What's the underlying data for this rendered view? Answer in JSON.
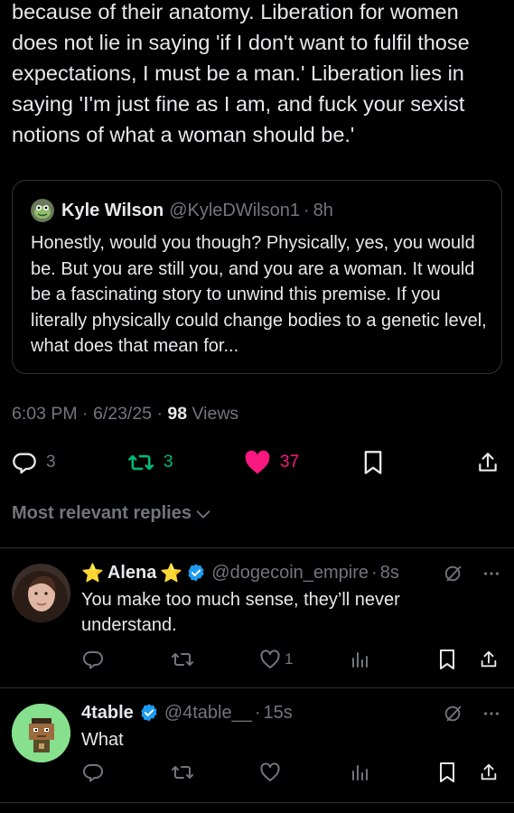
{
  "post": {
    "text": "because of their anatomy. Liberation for women\ndoes not lie in saying 'if I don't want to fulfil those\nexpectations, I must be a man.' Liberation lies in\nsaying 'I'm just fine as I am, and fuck your sexist\nnotions of what a woman should be.'"
  },
  "quote": {
    "name": "Kyle Wilson",
    "handle": "@KyleDWilson1",
    "separator": "·",
    "time": "8h",
    "text": "Honestly, would you though? Physically, yes, you would be. But you are still you, and you are a woman. It would be a fascinating story to unwind this premise. If you literally physically could change bodies to a genetic level, what does that mean for..."
  },
  "meta": {
    "time": "6:03 PM",
    "date": "6/23/25",
    "separator": "·",
    "views_count": "98",
    "views_label": "Views"
  },
  "actions": {
    "replies": "3",
    "reposts": "3",
    "likes": "37",
    "icons": [
      "reply-icon",
      "repost-icon",
      "heart-icon",
      "bookmark-icon",
      "share-icon"
    ],
    "like_color": "#f91880",
    "repost_color": "#00ba7c"
  },
  "sort": {
    "label": "Most relevant replies"
  },
  "replies": [
    {
      "name": "Alena",
      "name_prefix": "⭐",
      "name_suffix": "⭐",
      "verified": true,
      "handle": "@dogecoin_empire",
      "separator": "·",
      "time": "8s",
      "text": "You make too much sense, they’ll never understand.",
      "likes": "1"
    },
    {
      "name": "4table",
      "verified": true,
      "handle": "@4table__",
      "separator": "·",
      "time": "15s",
      "text": "What",
      "likes": ""
    }
  ],
  "colors": {
    "background": "#000000",
    "text": "#e7e9ea",
    "muted": "#71767b",
    "border": "#2f3336",
    "verified": "#1d9bf0"
  }
}
